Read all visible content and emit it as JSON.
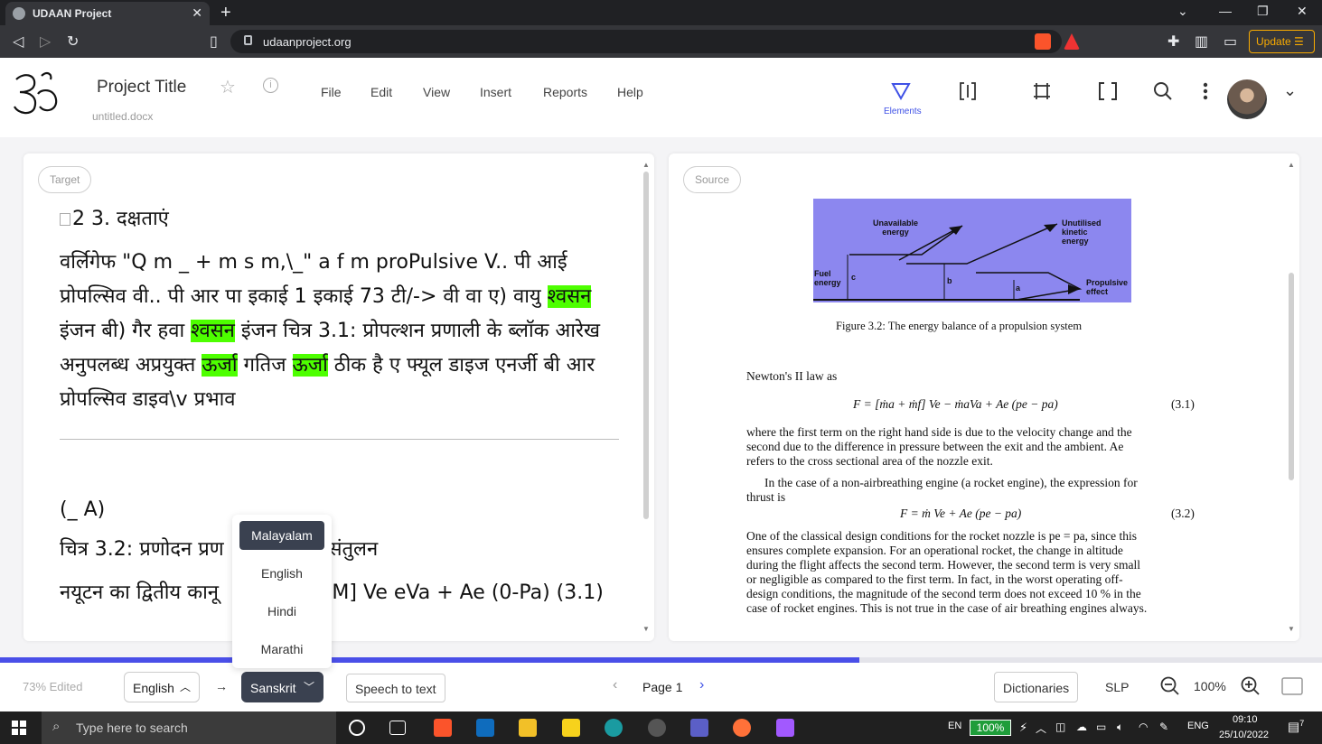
{
  "browser": {
    "tab_title": "UDAAN Project",
    "url": "udaanproject.org",
    "update_label": "Update",
    "shield_badge": "1",
    "alert_badge": "2"
  },
  "header": {
    "project_title": "Project Title",
    "file_name": "untitled.docx",
    "menu": [
      "File",
      "Edit",
      "View",
      "Insert",
      "Reports",
      "Help"
    ],
    "elements_label": "Elements",
    "accent": "#3f51e6"
  },
  "target": {
    "pill": "Target",
    "line1": "2 3. दक्षताएं",
    "para": [
      [
        "वर्लिगेफ \"Q m _ + m s m,\\_\" a f m proPulsive V.. पी आई"
      ],
      [
        "प्रोपल्सिव वी.. पी आर पा इकाई 1 इकाई 73 टी/-> वी वा ए) वायु ",
        "श्वसन"
      ],
      [
        "इंजन बी) गैर हवा ",
        "श्वसन",
        " इंजन चित्र 3.1: प्रोपल्शन प्रणाली के ब्लॉक आरेख"
      ],
      [
        "अनुपलब्ध अप्रयुक्त ",
        "ऊर्जा",
        " गतिज ",
        "ऊर्जा",
        " ठीक है ए फ्यूल डाइज एनर्जी बी आर"
      ],
      [
        "प्रोपल्सिव डाइव\\v प्रभाव"
      ]
    ],
    "lower1": "(_ A)",
    "lower2_a": "चित्र 3.2: प्रणोदन प्रण",
    "lower2_b": "संतुलन",
    "lower3_a": "नयूटन का द्वितीय कानू",
    "lower3_b": "+ M] Ve eVa + Ae (0-Pa) (3.1)",
    "highlight_color": "#4dff00"
  },
  "source": {
    "pill": "Source",
    "fig_labels": {
      "unavailable": "Unavailable energy",
      "unutilised": "Unutilised kinetic energy",
      "fuel": "Fuel energy",
      "propulsive": "Propulsive effect",
      "a": "a",
      "b": "b",
      "c": "c"
    },
    "caption": "Figure 3.2: The energy balance of a propulsion system",
    "newton": "Newton's II law as",
    "eq1": "F = [ṁa + ṁf] Ve − ṁaVa + Ae (pe − pa)",
    "eq1_num": "(3.1)",
    "p1": [
      "where the first term on the right hand side is due to the velocity change and the",
      "second due to the difference in pressure between the exit and the ambient.  Ae",
      "refers to the cross sectional area of the nozzle exit."
    ],
    "p2": [
      "In the case of a non-airbreathing engine (a rocket engine), the expression for",
      "thrust is"
    ],
    "eq2": "F = ṁ Ve + Ae (pe − pa)",
    "eq2_num": "(3.2)",
    "p3": [
      "One of the classical design conditions for the rocket nozzle is pe = pa, since this",
      "ensures complete expansion.  For an operational rocket, the change in altitude",
      "during the flight affects the second term. However, the second term is very small",
      "or negligible as compared to the first term.  In fact, in the worst operating off-",
      "design conditions, the magnitude of the second term does not exceed 10 % in the",
      "case of rocket engines. This is not true in the case of air breathing engines always."
    ],
    "fig_color": "#8c87ef"
  },
  "lang_menu": [
    "Malayalam",
    "English",
    "Hindi",
    "Marathi"
  ],
  "bottom": {
    "edited": "73% Edited",
    "edited_fraction": 0.65,
    "source_lang": "English",
    "target_lang": "Sanskrit",
    "speech": "Speech to text",
    "page": "Page 1",
    "dictionaries": "Dictionaries",
    "slp": "SLP",
    "zoom": "100%"
  },
  "taskbar": {
    "search_placeholder": "Type here to search",
    "lang": "EN",
    "battery": "100%",
    "input": "ENG",
    "time": "09:10",
    "date": "25/10/2022",
    "notif": "7"
  }
}
